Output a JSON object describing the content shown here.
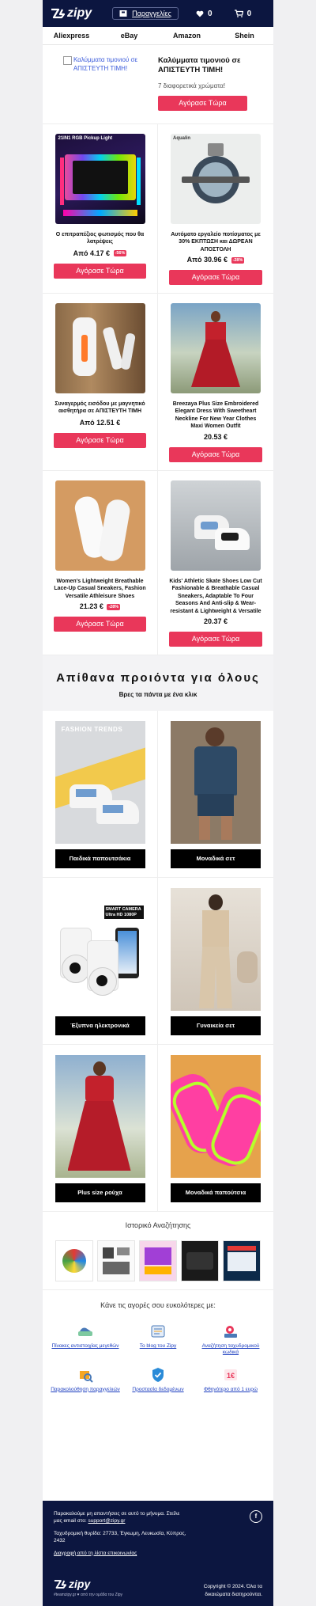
{
  "header": {
    "logo_text": "zipy",
    "orders_label": "Παραγγελίες",
    "favorites_count": "0",
    "cart_count": "0"
  },
  "nav": [
    {
      "label": "Aliexpress"
    },
    {
      "label": "eBay"
    },
    {
      "label": "Amazon"
    },
    {
      "label": "Shein"
    }
  ],
  "hero": {
    "image_alt": "Καλύμματα τιμονιού σε ΑΠΙΣΤΕΥΤΗ ΤΙΜΗ!",
    "title": "Καλύμματα τιμονιού σε ΑΠΙΣΤΕΥΤΗ ΤΙΜΗ!",
    "subtitle": "7 διαφορετικά χρώματα!",
    "cta": "Αγόρασε Τώρα"
  },
  "products": [
    {
      "name": "Ο επιτραπέζιος φωτισμός που θα λατρέψεις",
      "price": "Από 4.17 €",
      "discount": "-56%",
      "cta": "Αγόρασε Τώρα",
      "image_caption": "21IN1 RGB Pickup Light"
    },
    {
      "name": "Αυτόματο εργαλείο ποτίσματος με 30% ΕΚΠΤΩΣΗ και ΔΩΡΕΑΝ ΑΠΟΣΤΟΛΗ",
      "price": "Από 30.96 €",
      "discount": "-28%",
      "cta": "Αγόρασε Τώρα",
      "image_caption": "Aqualin"
    },
    {
      "name": "Συναγερμός εισόδου με μαγνητικό αισθητήρα σε ΑΠΙΣΤΕΥΤΗ ΤΙΜΗ",
      "price": "Από 12.51 €",
      "discount": "",
      "cta": "Αγόρασε Τώρα",
      "image_caption": ""
    },
    {
      "name": "Breezaya Plus Size Embroidered Elegant Dress With Sweetheart Neckline For New Year Clothes Maxi Women Outfit",
      "price": "20.53 €",
      "discount": "",
      "cta": "Αγόρασε Τώρα",
      "image_caption": ""
    },
    {
      "name": "Women's Lightweight Breathable Lace-Up Casual Sneakers, Fashion Versatile Athleisure Shoes",
      "price": "21.23 €",
      "discount": "-28%",
      "cta": "Αγόρασε Τώρα",
      "image_caption": ""
    },
    {
      "name": "Kids' Athletic Skate Shoes Low Cut Fashionable & Breathable Casual Sneakers, Adaptable To Four Seasons And Anti-slip & Wear-resistant & Lightweight & Versatile",
      "price": "20.37 €",
      "discount": "",
      "cta": "Αγόρασε Τώρα",
      "image_caption": ""
    }
  ],
  "section": {
    "title": "Απίθανα προιόντα για όλους",
    "subtitle": "Βρες τα πάντα με ένα κλικ"
  },
  "categories": [
    {
      "label": "Παιδικά παπουτσάκια",
      "image_caption": "FASHION TRENDS"
    },
    {
      "label": "Μοναδικά σετ",
      "image_caption": ""
    },
    {
      "label": "Έξυπνα ηλεκτρονικά",
      "image_caption": "SMART CAMERA Ultra HD 1080P"
    },
    {
      "label": "Γυναικεία σετ",
      "image_caption": ""
    },
    {
      "label": "Plus size ρούχα",
      "image_caption": ""
    },
    {
      "label": "Μοναδικά παπούτσια",
      "image_caption": ""
    }
  ],
  "history": {
    "title": "Ιστορικό Αναζήτησης"
  },
  "shop_easier": {
    "title": "Κάνε τις αγορές σου ευκολότερες με:",
    "links": [
      {
        "label": "Πίνακες αντιστοιχίας μεγεθών",
        "icon": "size-chart-icon"
      },
      {
        "label": "Το blog του Zipy",
        "icon": "blog-icon"
      },
      {
        "label": "Αναζήτηση ταχυδρομικού κωδικά",
        "icon": "postcode-search-icon"
      },
      {
        "label": "Παρακολούθηση παραγγελιών",
        "icon": "order-tracking-icon"
      },
      {
        "label": "Προστασία δεδομένων",
        "icon": "data-protection-icon"
      },
      {
        "label": "Φθηνότερο από 1 ευρώ",
        "icon": "one-euro-icon"
      }
    ]
  },
  "footer": {
    "contact_text": "Παρακαλούμε μη απαντήσεις σε αυτό το μήνυμα. Στείλε μας email στο:",
    "email": "support@zipy.gr",
    "address": "Ταχυδρομική θυρίδα: 27733, Έγκωμη, Λευκωσία, Κύπρος, 2432",
    "unsubscribe": "Διαγραφή από τη λίστα επικοινωνίας",
    "logo_text": "zipy",
    "tagline": "#teamzipy.gr ♥ από την ομάδα του Zipy",
    "copyright": "Copyright © 2024. Όλα τα δικαιώματα διατηρούνται."
  },
  "colors": {
    "brand_navy": "#0c1640",
    "cta_pink": "#e9375a",
    "link_blue": "#1a3cbf"
  }
}
